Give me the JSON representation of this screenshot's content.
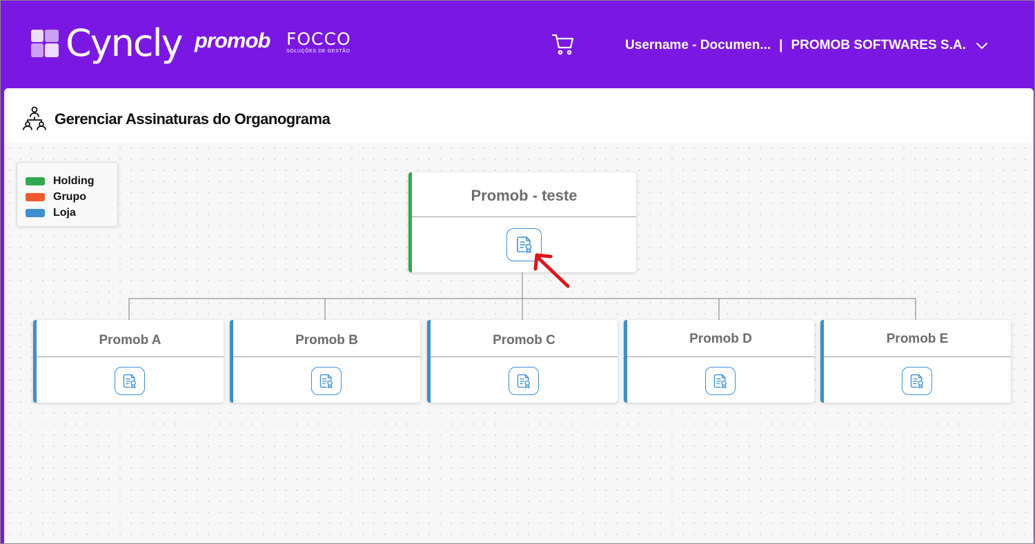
{
  "header": {
    "brand_main": "Cyncly",
    "brand_promob": "promob",
    "brand_focco": "FOCCO",
    "brand_focco_tagline": "SOLUÇÕES DE GESTÃO",
    "user": "Username - Documen...",
    "separator": "|",
    "company": "PROMOB SOFTWARES S.A."
  },
  "page": {
    "title": "Gerenciar Assinaturas do Organograma"
  },
  "legend": [
    {
      "label": "Holding",
      "color": "#2faa4f"
    },
    {
      "label": "Grupo",
      "color": "#f05a2a"
    },
    {
      "label": "Loja",
      "color": "#3a8fd0"
    }
  ],
  "org": {
    "root": {
      "name": "Promob - teste",
      "type": "Holding"
    },
    "children": [
      {
        "name": "Promob A",
        "type": "Loja"
      },
      {
        "name": "Promob B",
        "type": "Loja"
      },
      {
        "name": "Promob C",
        "type": "Loja"
      },
      {
        "name": "Promob D",
        "type": "Loja"
      },
      {
        "name": "Promob E",
        "type": "Loja"
      }
    ]
  },
  "colors": {
    "header_bg": "#7a17e3",
    "holding": "#2faa4f",
    "loja": "#3a8fd0",
    "icon_blue": "#3a8fd8",
    "annotation_arrow": "#e3131b"
  }
}
